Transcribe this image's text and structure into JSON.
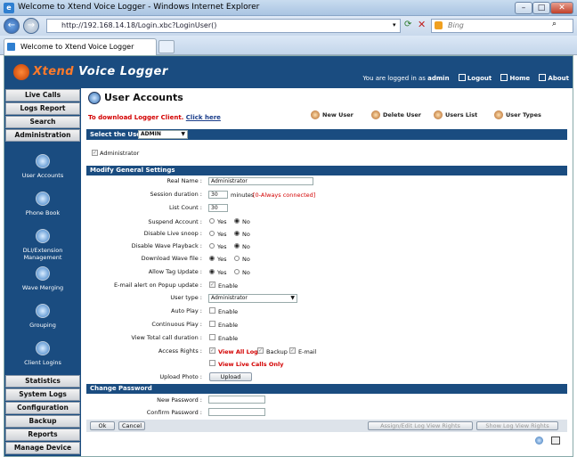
{
  "window": {
    "title": "Welcome to Xtend Voice Logger - Windows Internet Explorer",
    "url": "http://192.168.14.18/Login.xbc?LoginUser()",
    "search_placeholder": "Bing",
    "tab_label": "Welcome to Xtend Voice Logger"
  },
  "header": {
    "brand_part1": "Xtend",
    "brand_part2": "Voice Logger",
    "logged_in_text": "You are logged in as",
    "user": "admin",
    "logout": "Logout",
    "home": "Home",
    "about": "About"
  },
  "sidebar": {
    "top": [
      "Live Calls",
      "Logs Report",
      "Search",
      "Administration"
    ],
    "items": [
      "User Accounts",
      "Phone Book",
      "DLI/Extension Management",
      "Wave Merging",
      "Grouping",
      "Client Logins"
    ],
    "bottom": [
      "Statistics",
      "System Logs",
      "Configuration",
      "Backup",
      "Reports",
      "Manage Device"
    ]
  },
  "main": {
    "title": "User Accounts",
    "download_text": "To download Logger Client.",
    "download_link": "Click here",
    "tools": [
      "New User",
      "Delete User",
      "Users List",
      "User Types"
    ],
    "select_user_label": "Select the User",
    "selected_user": "ADMIN",
    "admin_checkbox": "Administrator",
    "section_general": "Modify General Settings",
    "section_password": "Change Password"
  },
  "form": {
    "real_name_label": "Real Name :",
    "real_name": "Administrator",
    "session_label": "Session duration :",
    "session_value": "30",
    "session_unit": "minutes",
    "session_hint": "[0-Always connected]",
    "list_count_label": "List Count :",
    "list_count": "30",
    "suspend_label": "Suspend Account :",
    "live_snoop_label": "Disable Live snoop :",
    "wave_playback_label": "Disable Wave Playback :",
    "download_wave_label": "Download Wave file :",
    "allow_tag_label": "Allow Tag Update :",
    "yes": "Yes",
    "no": "No",
    "email_alert_label": "E-mail alert on Popup update :",
    "enable": "Enable",
    "user_type_label": "User type :",
    "user_type": "Administrator",
    "auto_play_label": "Auto Play :",
    "continuous_label": "Continuous Play :",
    "total_duration_label": "View Total call duration :",
    "access_rights_label": "Access Rights :",
    "view_all_logs": "View All Logs",
    "backup": "Backup",
    "email": "E-mail",
    "view_live_only": "View Live Calls Only",
    "upload_photo_label": "Upload Photo :",
    "upload_btn": "Upload",
    "new_password_label": "New Password :",
    "confirm_password_label": "Confirm Password :",
    "ok_btn": "Ok",
    "cancel_btn": "Cancel",
    "assign_btn": "Assign/Edit Log View Rights",
    "show_btn": "Show Log View Rights"
  },
  "colors": {
    "banner": "#1a4c80",
    "accent_red": "#d30000"
  }
}
